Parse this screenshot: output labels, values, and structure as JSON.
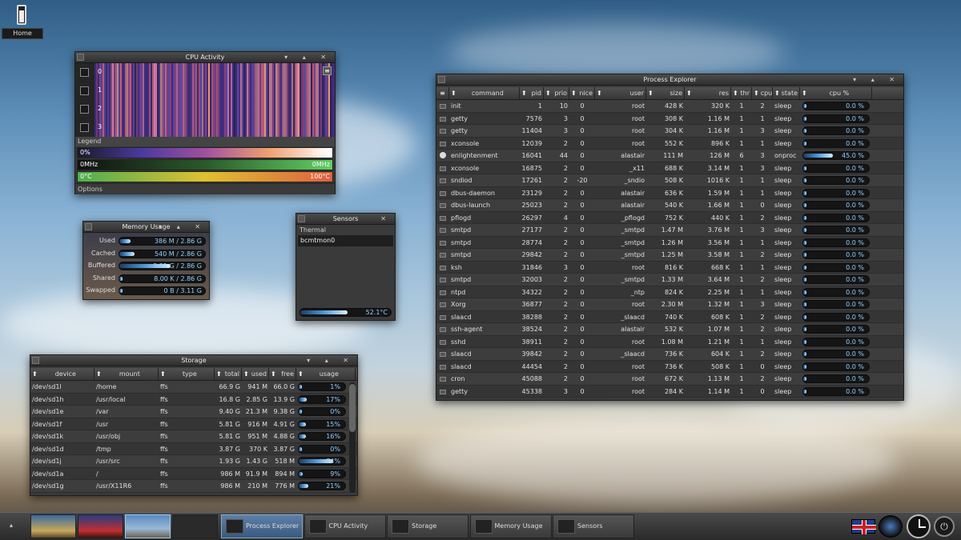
{
  "desktop": {
    "home_label": "Home"
  },
  "cpu": {
    "title": "CPU Activity",
    "cores": [
      "0",
      "1",
      "2",
      "3"
    ],
    "legend_label": "Legend",
    "options_label": "Options",
    "legend": [
      {
        "left": "0%",
        "right": "100%"
      },
      {
        "left": "0MHz",
        "right": "0MHz"
      },
      {
        "left": "0°C",
        "right": "100°C"
      }
    ]
  },
  "memory": {
    "title": "Memory Usage",
    "rows": [
      {
        "label": "Used",
        "value": "386 M / 2.86 G",
        "pct": 13
      },
      {
        "label": "Cached",
        "value": "540 M / 2.86 G",
        "pct": 18
      },
      {
        "label": "Buffered",
        "value": "3.31 G / 2.86 G",
        "pct": 60
      },
      {
        "label": "Shared",
        "value": "8.00 K / 2.86 G",
        "pct": 1
      },
      {
        "label": "Swapped",
        "value": "0 B / 3.11 G",
        "pct": 1
      }
    ]
  },
  "sensors": {
    "title": "Sensors",
    "group": "Thermal",
    "item": "bcmtmon0",
    "value": "52.1°C",
    "pct": 52
  },
  "storage": {
    "title": "Storage",
    "headers": [
      "device",
      "mount",
      "type",
      "total",
      "used",
      "free",
      "usage"
    ],
    "rows": [
      {
        "device": "/dev/sd1l",
        "mount": "/home",
        "type": "ffs",
        "total": "66.9 G",
        "used": "941 M",
        "free": "66.0 G",
        "usage": "1%",
        "pct": 1
      },
      {
        "device": "/dev/sd1h",
        "mount": "/usr/local",
        "type": "ffs",
        "total": "16.8 G",
        "used": "2.85 G",
        "free": "13.9 G",
        "usage": "17%",
        "pct": 17
      },
      {
        "device": "/dev/sd1e",
        "mount": "/var",
        "type": "ffs",
        "total": "9.40 G",
        "used": "21.3 M",
        "free": "9.38 G",
        "usage": "0%",
        "pct": 0
      },
      {
        "device": "/dev/sd1f",
        "mount": "/usr",
        "type": "ffs",
        "total": "5.81 G",
        "used": "916 M",
        "free": "4.91 G",
        "usage": "15%",
        "pct": 15
      },
      {
        "device": "/dev/sd1k",
        "mount": "/usr/obj",
        "type": "ffs",
        "total": "5.81 G",
        "used": "951 M",
        "free": "4.88 G",
        "usage": "16%",
        "pct": 16
      },
      {
        "device": "/dev/sd1d",
        "mount": "/tmp",
        "type": "ffs",
        "total": "3.87 G",
        "used": "370 K",
        "free": "3.87 G",
        "usage": "0%",
        "pct": 0
      },
      {
        "device": "/dev/sd1j",
        "mount": "/usr/src",
        "type": "ffs",
        "total": "1.93 G",
        "used": "1.43 G",
        "free": "518 M",
        "usage": "74%",
        "pct": 74
      },
      {
        "device": "/dev/sd1a",
        "mount": "/",
        "type": "ffs",
        "total": "986 M",
        "used": "91.9 M",
        "free": "894 M",
        "usage": "9%",
        "pct": 9
      },
      {
        "device": "/dev/sd1g",
        "mount": "/usr/X11R6",
        "type": "ffs",
        "total": "986 M",
        "used": "210 M",
        "free": "776 M",
        "usage": "21%",
        "pct": 21
      }
    ]
  },
  "process": {
    "title": "Process Explorer",
    "headers": [
      "command",
      "pid",
      "prio",
      "nice",
      "user",
      "size",
      "res",
      "thr",
      "cpu",
      "state",
      "cpu %"
    ],
    "rows": [
      [
        "init",
        "1",
        "10",
        "0",
        "root",
        "428 K",
        "320 K",
        "1",
        "2",
        "sleep",
        "0.0 %",
        0
      ],
      [
        "getty",
        "7576",
        "3",
        "0",
        "root",
        "308 K",
        "1.16 M",
        "1",
        "1",
        "sleep",
        "0.0 %",
        0
      ],
      [
        "getty",
        "11404",
        "3",
        "0",
        "root",
        "304 K",
        "1.16 M",
        "1",
        "3",
        "sleep",
        "0.0 %",
        0
      ],
      [
        "xconsole",
        "12039",
        "2",
        "0",
        "root",
        "552 K",
        "896 K",
        "1",
        "1",
        "sleep",
        "0.0 %",
        0
      ],
      [
        "enlightenment",
        "16041",
        "44",
        "0",
        "alastair",
        "111 M",
        "126 M",
        "6",
        "3",
        "onproc",
        "45.0 %",
        45
      ],
      [
        "xconsole",
        "16875",
        "2",
        "0",
        "_x11",
        "688 K",
        "3.14 M",
        "1",
        "3",
        "sleep",
        "0.0 %",
        0
      ],
      [
        "sndiod",
        "17261",
        "2",
        "-20",
        "_sndio",
        "508 K",
        "1016 K",
        "1",
        "1",
        "sleep",
        "0.0 %",
        0
      ],
      [
        "dbus-daemon",
        "23129",
        "2",
        "0",
        "alastair",
        "636 K",
        "1.59 M",
        "1",
        "1",
        "sleep",
        "0.0 %",
        0
      ],
      [
        "dbus-launch",
        "25023",
        "2",
        "0",
        "alastair",
        "540 K",
        "1.66 M",
        "1",
        "0",
        "sleep",
        "0.0 %",
        0
      ],
      [
        "pflogd",
        "26297",
        "4",
        "0",
        "_pflogd",
        "752 K",
        "440 K",
        "1",
        "2",
        "sleep",
        "0.0 %",
        0
      ],
      [
        "smtpd",
        "27177",
        "2",
        "0",
        "_smtpd",
        "1.47 M",
        "3.76 M",
        "1",
        "3",
        "sleep",
        "0.0 %",
        0
      ],
      [
        "smtpd",
        "28774",
        "2",
        "0",
        "_smtpd",
        "1.26 M",
        "3.56 M",
        "1",
        "1",
        "sleep",
        "0.0 %",
        0
      ],
      [
        "smtpd",
        "29842",
        "2",
        "0",
        "_smtpd",
        "1.25 M",
        "3.58 M",
        "1",
        "2",
        "sleep",
        "0.0 %",
        0
      ],
      [
        "ksh",
        "31846",
        "3",
        "0",
        "root",
        "816 K",
        "668 K",
        "1",
        "1",
        "sleep",
        "0.0 %",
        0
      ],
      [
        "smtpd",
        "32003",
        "2",
        "0",
        "_smtpd",
        "1.33 M",
        "3.64 M",
        "1",
        "2",
        "sleep",
        "0.0 %",
        0
      ],
      [
        "ntpd",
        "34322",
        "2",
        "0",
        "_ntp",
        "824 K",
        "2.25 M",
        "1",
        "1",
        "sleep",
        "0.0 %",
        0
      ],
      [
        "Xorg",
        "36877",
        "2",
        "0",
        "root",
        "2.30 M",
        "1.32 M",
        "1",
        "3",
        "sleep",
        "0.0 %",
        0
      ],
      [
        "slaacd",
        "38288",
        "2",
        "0",
        "_slaacd",
        "740 K",
        "608 K",
        "1",
        "2",
        "sleep",
        "0.0 %",
        0
      ],
      [
        "ssh-agent",
        "38524",
        "2",
        "0",
        "alastair",
        "532 K",
        "1.07 M",
        "1",
        "2",
        "sleep",
        "0.0 %",
        0
      ],
      [
        "sshd",
        "38911",
        "2",
        "0",
        "root",
        "1.08 M",
        "1.21 M",
        "1",
        "1",
        "sleep",
        "0.0 %",
        0
      ],
      [
        "slaacd",
        "39842",
        "2",
        "0",
        "_slaacd",
        "736 K",
        "604 K",
        "1",
        "2",
        "sleep",
        "0.0 %",
        0
      ],
      [
        "slaacd",
        "44454",
        "2",
        "0",
        "root",
        "736 K",
        "508 K",
        "1",
        "0",
        "sleep",
        "0.0 %",
        0
      ],
      [
        "cron",
        "45088",
        "2",
        "0",
        "root",
        "672 K",
        "1.13 M",
        "1",
        "2",
        "sleep",
        "0.0 %",
        0
      ],
      [
        "getty",
        "45338",
        "3",
        "0",
        "root",
        "284 K",
        "1.14 M",
        "1",
        "0",
        "sleep",
        "0.0 %",
        0
      ]
    ]
  },
  "taskbar": {
    "tasks": [
      "Process Explorer",
      "CPU Activity",
      "Storage",
      "Memory Usage",
      "Sensors"
    ]
  }
}
